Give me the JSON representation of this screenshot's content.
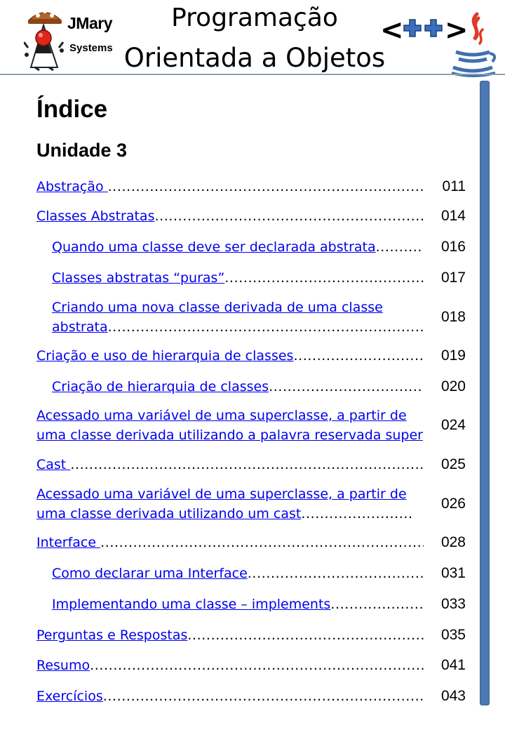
{
  "header": {
    "brand_name": "JMary",
    "brand_sub": "Systems",
    "title_line1": "Programação",
    "title_line2": "Orientada a Objetos",
    "cpp_logo_text": "<++>",
    "colors": {
      "rule": "#8aa0b0",
      "sidebar": "#4c79b4",
      "link": "#0000ee",
      "java_red": "#e03a2a",
      "java_blue": "#3f6fb0"
    }
  },
  "heading": "Índice",
  "unit": "Unidade 3",
  "toc": [
    {
      "label": "Abstração ",
      "page": "011",
      "level": 1
    },
    {
      "label": "Classes Abstratas",
      "page": "014",
      "level": 1
    },
    {
      "label": "Quando uma classe deve ser declarada abstrata",
      "page": "016",
      "level": 2
    },
    {
      "label": "Classes abstratas “puras”",
      "page": "017",
      "level": 2
    },
    {
      "label": "Criando uma nova classe derivada de uma classe abstrata",
      "page": "018",
      "level": 2
    },
    {
      "label": "Criação e uso de hierarquia de classes",
      "page": "019",
      "level": 1
    },
    {
      "label": "Criação de hierarquia de classes",
      "page": "020",
      "level": 2
    },
    {
      "label": "Acessado uma variável de uma superclasse, a partir de uma classe derivada utilizando a palavra reservada super",
      "page": "024",
      "level": 1
    },
    {
      "label": "Cast ",
      "page": "025",
      "level": 1
    },
    {
      "label": "Acessado uma variável de uma superclasse, a partir de uma classe derivada utilizando um cast",
      "page": "026",
      "level": 1
    },
    {
      "label": "Interface ",
      "page": "028",
      "level": 1
    },
    {
      "label": "Como declarar uma Interface",
      "page": "031",
      "level": 2
    },
    {
      "label": "Implementando uma classe – implements",
      "page": "033",
      "level": 2
    },
    {
      "label": "Perguntas e Respostas",
      "page": "035",
      "level": 1
    },
    {
      "label": "Resumo",
      "page": "041",
      "level": 1
    },
    {
      "label": "Exercícios",
      "page": "043",
      "level": 1
    }
  ]
}
